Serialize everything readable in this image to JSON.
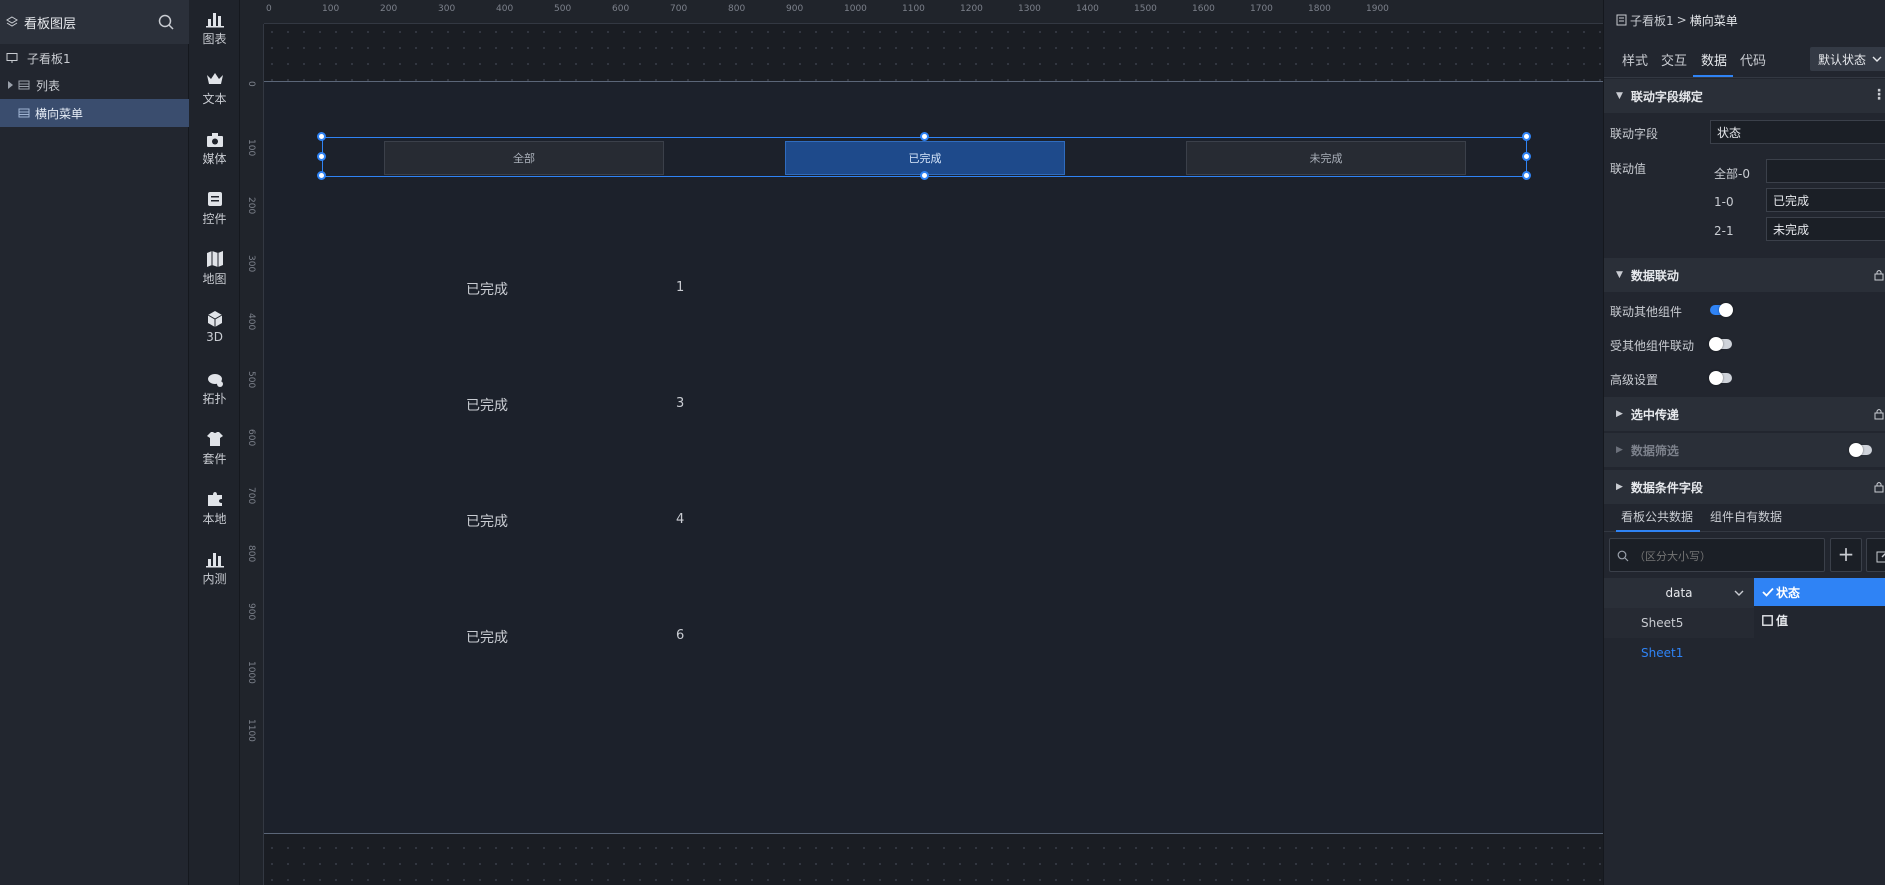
{
  "layers": {
    "title": "看板图层",
    "items": [
      {
        "label": "子看板1"
      },
      {
        "label": "列表"
      },
      {
        "label": "横向菜单"
      }
    ]
  },
  "components": [
    {
      "label": "图表",
      "icon": "bar-chart-icon"
    },
    {
      "label": "文本",
      "icon": "crown-icon"
    },
    {
      "label": "媒体",
      "icon": "media-icon"
    },
    {
      "label": "控件",
      "icon": "widget-icon"
    },
    {
      "label": "地图",
      "icon": "map-icon"
    },
    {
      "label": "3D",
      "icon": "cube-icon"
    },
    {
      "label": "拓扑",
      "icon": "topology-icon"
    },
    {
      "label": "套件",
      "icon": "shirt-icon"
    },
    {
      "label": "本地",
      "icon": "puzzle-icon"
    },
    {
      "label": "内测",
      "icon": "bar-chart-icon"
    }
  ],
  "rulers": {
    "top": [
      "0",
      "100",
      "200",
      "300",
      "400",
      "500",
      "600",
      "700",
      "800",
      "900",
      "1000",
      "1100",
      "1200",
      "1300",
      "1400",
      "1500",
      "1600",
      "1700",
      "1800",
      "1900"
    ],
    "left": [
      "0",
      "100",
      "200",
      "300",
      "400",
      "500",
      "600",
      "700",
      "800",
      "900",
      "1000",
      "1100"
    ]
  },
  "canvas": {
    "menu_buttons": [
      {
        "label": "全部"
      },
      {
        "label": "已完成",
        "active": true
      },
      {
        "label": "未完成"
      }
    ],
    "list_rows": [
      {
        "label": "已完成",
        "value": "1"
      },
      {
        "label": "已完成",
        "value": "3"
      },
      {
        "label": "已完成",
        "value": "4"
      },
      {
        "label": "已完成",
        "value": "6"
      }
    ]
  },
  "props": {
    "breadcrumb": {
      "parent": "子看板1",
      "separator": ">",
      "current": "横向菜单"
    },
    "tabs": [
      "样式",
      "交互",
      "数据",
      "代码"
    ],
    "active_tab": "数据",
    "state_select": "默认状态",
    "section_link_binding": "联动字段绑定",
    "link_field_label": "联动字段",
    "link_field_value": "状态",
    "link_values_label": "联动值",
    "link_values": [
      {
        "key": "全部-0",
        "value": ""
      },
      {
        "key": "1-0",
        "value": "已完成"
      },
      {
        "key": "2-1",
        "value": "未完成"
      }
    ],
    "section_data_link": "数据联动",
    "toggles": [
      {
        "label": "联动其他组件",
        "on": true
      },
      {
        "label": "受其他组件联动",
        "on": false
      },
      {
        "label": "高级设置",
        "on": false
      }
    ],
    "section_select_pass": "选中传递",
    "section_data_filter": "数据筛选",
    "section_condition": "数据条件字段",
    "data_tabs": [
      "看板公共数据",
      "组件自有数据"
    ],
    "search_placeholder": "（区分大小写）",
    "add_label": "+",
    "source_header": "data",
    "sources": [
      {
        "label": "Sheet5",
        "active": false
      },
      {
        "label": "Sheet1",
        "active": true
      }
    ],
    "fields": [
      {
        "label": "状态",
        "checked": true
      },
      {
        "label": "值",
        "checked": false
      }
    ]
  },
  "colors": {
    "accent": "#2f83f5",
    "panel": "#22262f",
    "canvas": "#1c212b",
    "active_button": "#1e4a8b"
  }
}
